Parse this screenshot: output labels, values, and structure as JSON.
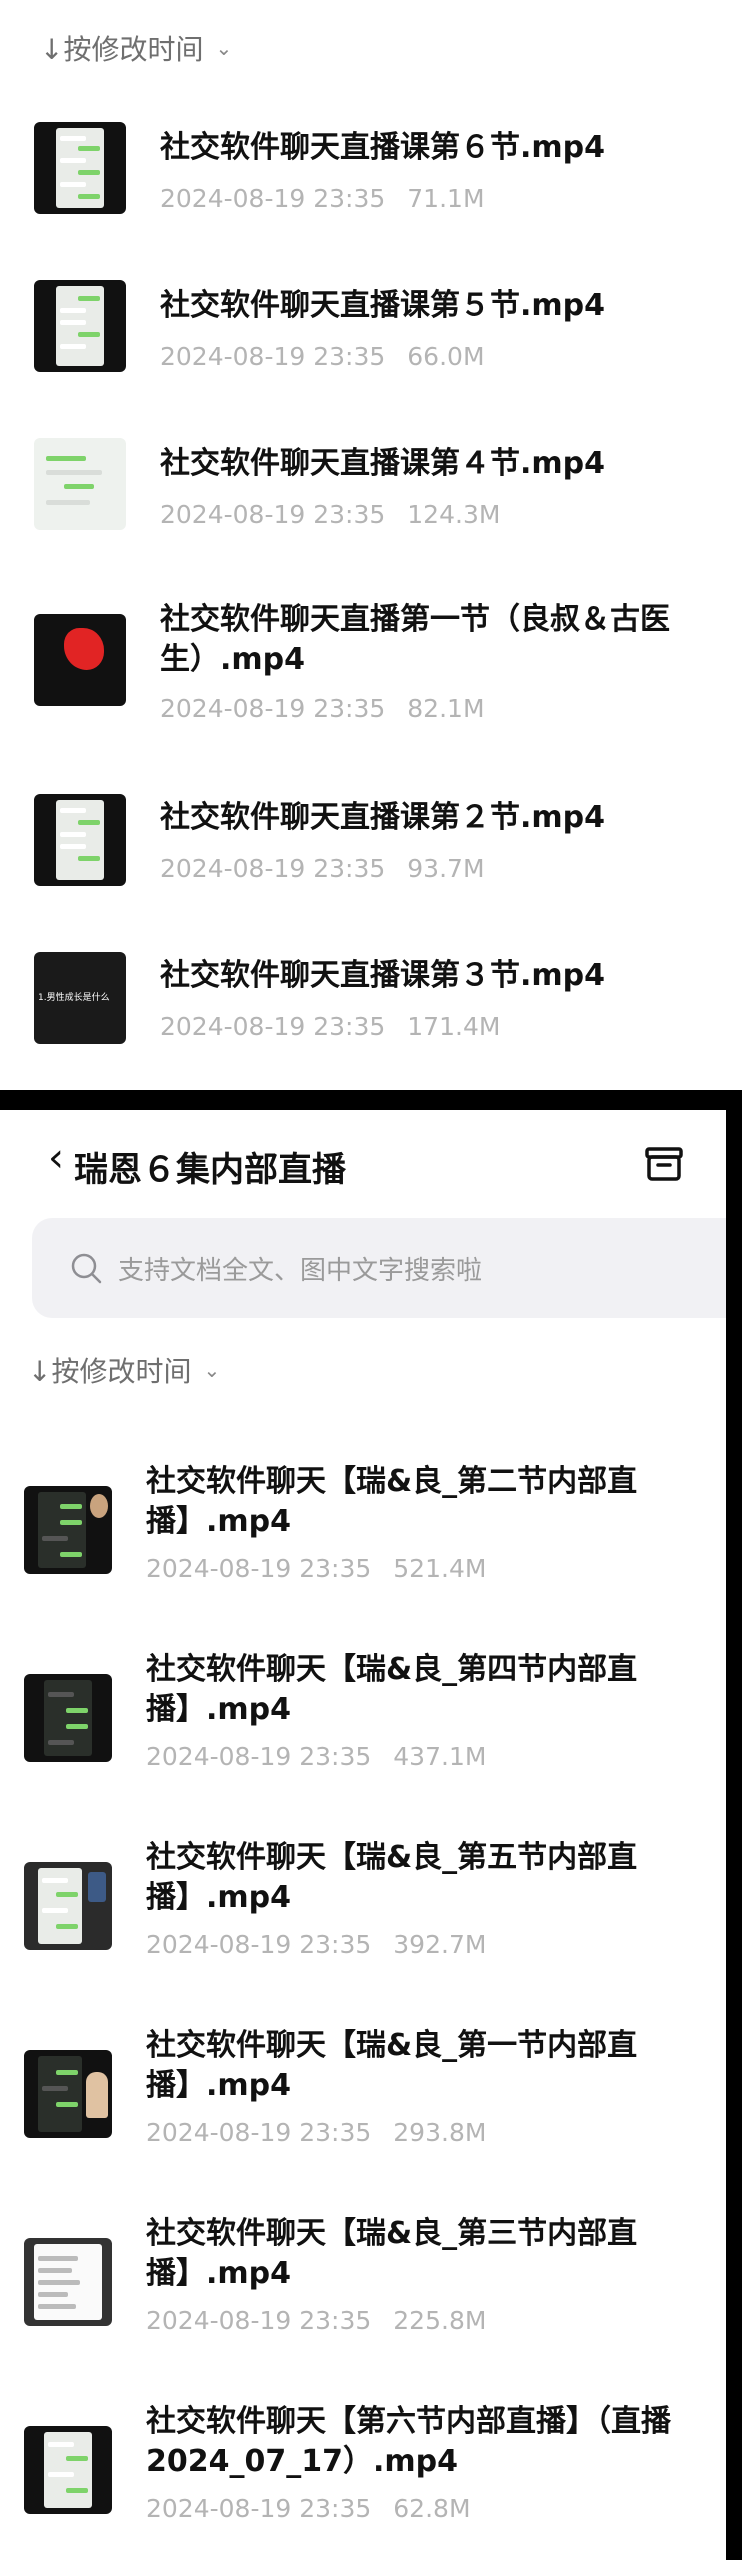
{
  "top": {
    "sort_label": "↓按修改时间",
    "items": [
      {
        "title": "社交软件聊天直播课第６节.mp4",
        "date": "2024-08-19 23:35",
        "size": "71.1M"
      },
      {
        "title": "社交软件聊天直播课第５节.mp4",
        "date": "2024-08-19 23:35",
        "size": "66.0M"
      },
      {
        "title": "社交软件聊天直播课第４节.mp4",
        "date": "2024-08-19 23:35",
        "size": "124.3M"
      },
      {
        "title": "社交软件聊天直播第一节（良叔＆古医生）.mp4",
        "date": "2024-08-19 23:35",
        "size": "82.1M"
      },
      {
        "title": "社交软件聊天直播课第２节.mp4",
        "date": "2024-08-19 23:35",
        "size": "93.7M"
      },
      {
        "title": "社交软件聊天直播课第３节.mp4",
        "date": "2024-08-19 23:35",
        "size": "171.4M",
        "thumb_caption": "1.男性成长是什么"
      }
    ]
  },
  "bottom": {
    "header_title": "瑞恩６集内部直播",
    "search_placeholder": "支持文档全文、图中文字搜索啦",
    "sort_label": "↓按修改时间",
    "items": [
      {
        "title": "社交软件聊天【瑞&良_第二节内部直播】.mp4",
        "date": "2024-08-19 23:35",
        "size": "521.4M"
      },
      {
        "title": "社交软件聊天【瑞&良_第四节内部直播】.mp4",
        "date": "2024-08-19 23:35",
        "size": "437.1M"
      },
      {
        "title": "社交软件聊天【瑞&良_第五节内部直播】.mp4",
        "date": "2024-08-19 23:35",
        "size": "392.7M"
      },
      {
        "title": "社交软件聊天【瑞&良_第一节内部直播】.mp4",
        "date": "2024-08-19 23:35",
        "size": "293.8M"
      },
      {
        "title": "社交软件聊天【瑞&良_第三节内部直播】.mp4",
        "date": "2024-08-19 23:35",
        "size": "225.8M"
      },
      {
        "title": "社交软件聊天【第六节内部直播】（直播2024_07_17）.mp4",
        "date": "2024-08-19 23:35",
        "size": "62.8M"
      }
    ]
  },
  "icons": {
    "sort": "down-arrow-icon",
    "sort_toggle": "chevron-down-icon",
    "back": "back-chevron-icon",
    "archive": "archive-icon",
    "search": "search-icon"
  },
  "colors": {
    "meta_text": "#b4b4b4",
    "search_bg": "#f1f1f4",
    "chat_green": "#7ed36a"
  }
}
